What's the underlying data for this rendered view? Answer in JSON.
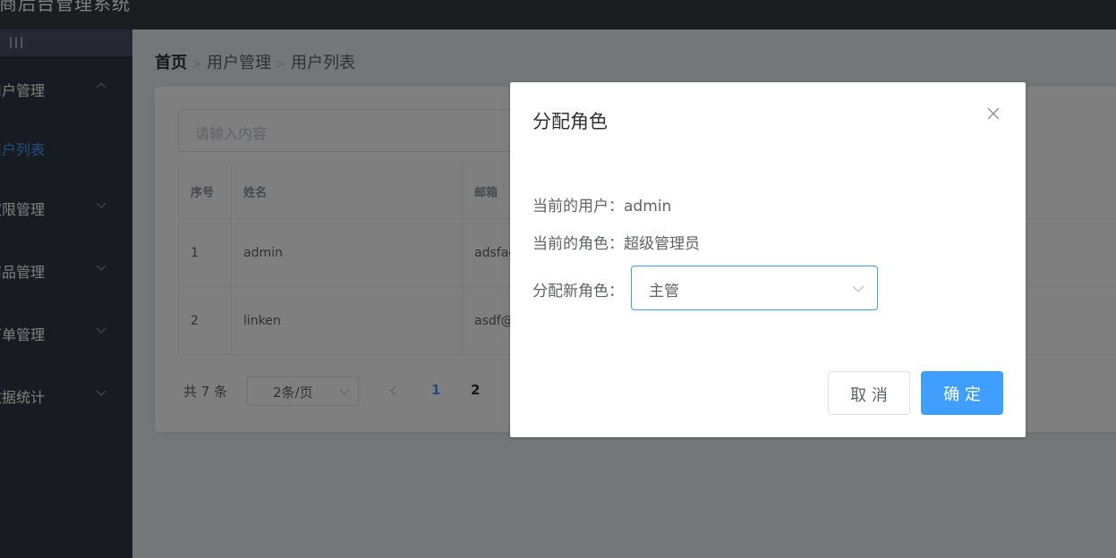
{
  "header": {
    "title": "电商后台管理系统"
  },
  "sidebar": {
    "toggle_label": "|||",
    "items": [
      {
        "label": "用户管理"
      },
      {
        "label": "用户列表"
      },
      {
        "label": "权限管理"
      },
      {
        "label": "商品管理"
      },
      {
        "label": "订单管理"
      },
      {
        "label": "数据统计"
      }
    ]
  },
  "breadcrumb": {
    "home": "首页",
    "level1": "用户管理",
    "level2": "用户列表"
  },
  "search": {
    "placeholder": "请输入内容"
  },
  "table": {
    "headers": [
      "序号",
      "姓名",
      "邮箱"
    ],
    "rows": [
      {
        "index": "1",
        "name": "admin",
        "email": "adsfad@qq.com"
      },
      {
        "index": "2",
        "name": "linken",
        "email": "asdf@qq.com"
      }
    ]
  },
  "pagination": {
    "total": "共 7 条",
    "page_size": "2条/页",
    "pages": [
      "1",
      "2"
    ],
    "current_page": "1"
  },
  "dialog": {
    "title": "分配角色",
    "current_user_label": "当前的用户：admin",
    "current_role_label": "当前的角色：超级管理员",
    "new_role_label": "分配新角色：",
    "selected_role": "主管",
    "cancel_label": "取 消",
    "confirm_label": "确 定"
  },
  "colors": {
    "primary": "#409eff",
    "sidebar_bg": "#333744",
    "header_bg": "#373d41",
    "main_bg": "#eaedf1"
  }
}
